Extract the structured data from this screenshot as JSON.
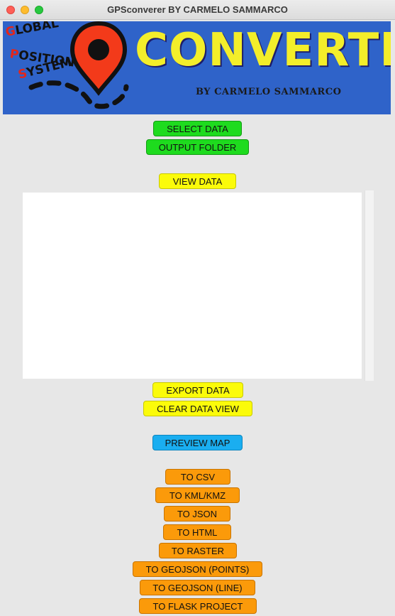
{
  "window": {
    "title": "GPSconverer BY CARMELO SAMMARCO"
  },
  "banner": {
    "word1_cap": "G",
    "word1_rest": "LOBAL",
    "word2_cap": "P",
    "word2_rest": "OSITION",
    "word3_cap": "S",
    "word3_rest": "YSTEM",
    "brand": "CONVERTER",
    "byline": "BY CARMELO SAMMARCO",
    "icon": "map-pin-icon",
    "colors": {
      "background": "#2f63c9",
      "brand": "#f3ee2a",
      "pin": "#f33a1a"
    }
  },
  "buttons": {
    "select_data": "SELECT DATA",
    "output_folder": "OUTPUT FOLDER",
    "view_data": "VIEW DATA",
    "export_data": "EXPORT DATA",
    "clear_data_view": "CLEAR DATA VIEW",
    "preview_map": "PREVIEW MAP",
    "to_csv": "TO CSV",
    "to_kml_kmz": "TO KML/KMZ",
    "to_json": "TO JSON",
    "to_html": "TO HTML",
    "to_raster": "TO RASTER",
    "to_geojson_points": "TO GEOJSON (POINTS)",
    "to_geojson_line": "TO GEOJSON (LINE)",
    "to_flask_project": "TO FLASK PROJECT"
  },
  "data_view": {
    "content": ""
  }
}
